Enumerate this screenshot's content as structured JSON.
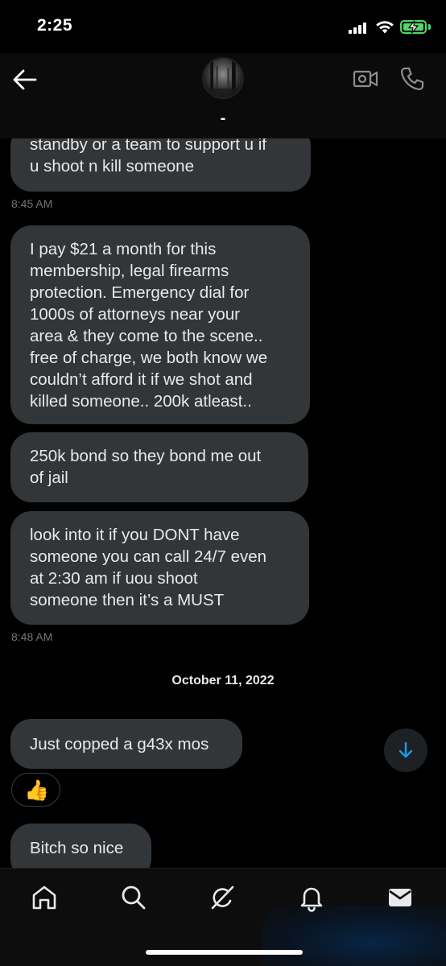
{
  "status_bar": {
    "time": "2:25"
  },
  "header": {
    "contact_name": "-"
  },
  "messages": [
    {
      "text": "standby or a team to support u if\nu shoot n kill someone"
    },
    {
      "text": "I pay $21 a month for this\nmembership, legal firearms\nprotection.  Emergency dial for\n1000s of attorneys near your\narea & they come to the scene..\nfree of charge, we both know we\ncouldn’t afford it if we shot and\nkilled someone.. 200k atleast.."
    },
    {
      "text": "250k bond so they bond me out\nof jail"
    },
    {
      "text": "look into it if you DONT have\nsomeone you can call 24/7 even\nat 2:30 am if uou shoot\nsomeone then it’s a MUST"
    },
    {
      "text": "Just copped a g43x mos"
    },
    {
      "text": "Bitch so nice"
    }
  ],
  "timestamps": [
    "8:45 AM",
    "8:48 AM"
  ],
  "date_separator": "October 11, 2022",
  "reaction": {
    "emoji": "👍"
  },
  "icons": {
    "back": "arrow-left-icon",
    "video": "video-camera-icon",
    "call": "phone-icon",
    "scroll": "arrow-down-icon",
    "tabs": [
      "home-icon",
      "search-icon",
      "grok-icon",
      "bell-icon",
      "envelope-icon"
    ]
  },
  "colors": {
    "accent": "#1d9bf0",
    "bubble": "#333639",
    "timestamp": "#71767b",
    "battery": "#4cd964"
  }
}
